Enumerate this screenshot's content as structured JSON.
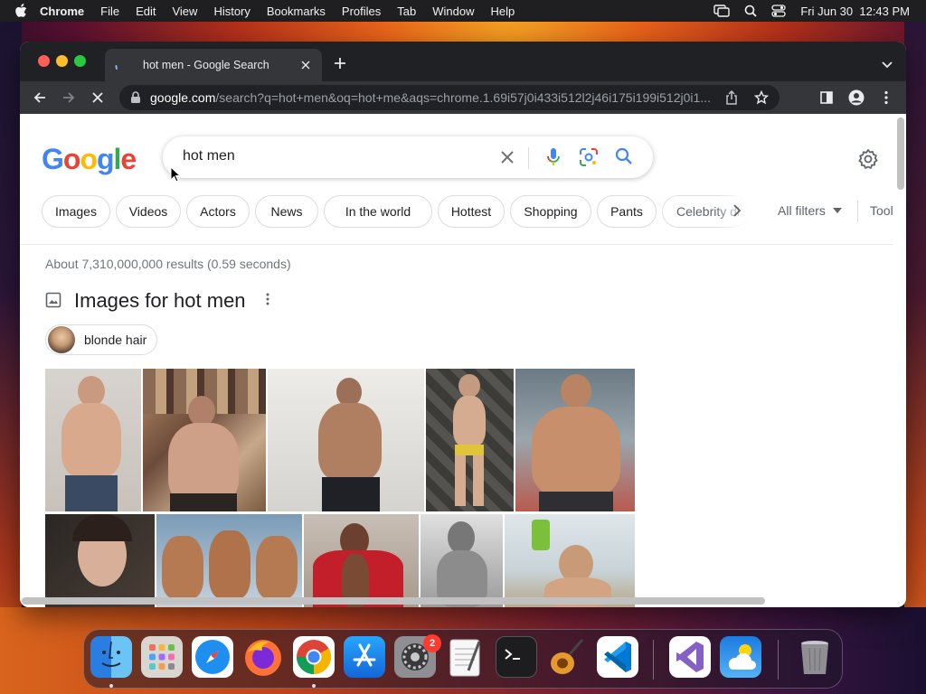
{
  "menubar": {
    "app_name": "Chrome",
    "items": [
      "File",
      "Edit",
      "View",
      "History",
      "Bookmarks",
      "Profiles",
      "Tab",
      "Window",
      "Help"
    ],
    "datetime": "Fri Jun 30  12:43 PM"
  },
  "browser": {
    "tab_title": "hot men - Google Search",
    "url_host": "google.com",
    "url_path": "/search?q=hot+men&oq=hot+me&aqs=chrome.1.69i57j0i433i512l2j46i175i199i512j0i1..."
  },
  "search": {
    "query": "hot men",
    "chips": [
      "Images",
      "Videos",
      "Actors",
      "News",
      "In the world",
      "Hottest",
      "Shopping",
      "Pants",
      "Celebrity di"
    ],
    "all_filters": "All filters",
    "tools": "Tool"
  },
  "results": {
    "stats": "About 7,310,000,000 results (0.59 seconds)",
    "images_title": "Images for hot men",
    "refine_chip": "blonde hair"
  },
  "dock": {
    "apps": [
      "Finder",
      "Launchpad",
      "Safari",
      "Firefox",
      "Chrome",
      "App Store",
      "System Settings",
      "TextEdit",
      "Terminal",
      "GarageBand",
      "Visual Studio Code",
      "Visual Studio",
      "Weather",
      "Trash"
    ],
    "settings_badge": "2"
  },
  "colors": {
    "google_blue": "#4285F4",
    "google_red": "#EA4335",
    "google_yellow": "#FBBC05",
    "google_green": "#34A853"
  }
}
